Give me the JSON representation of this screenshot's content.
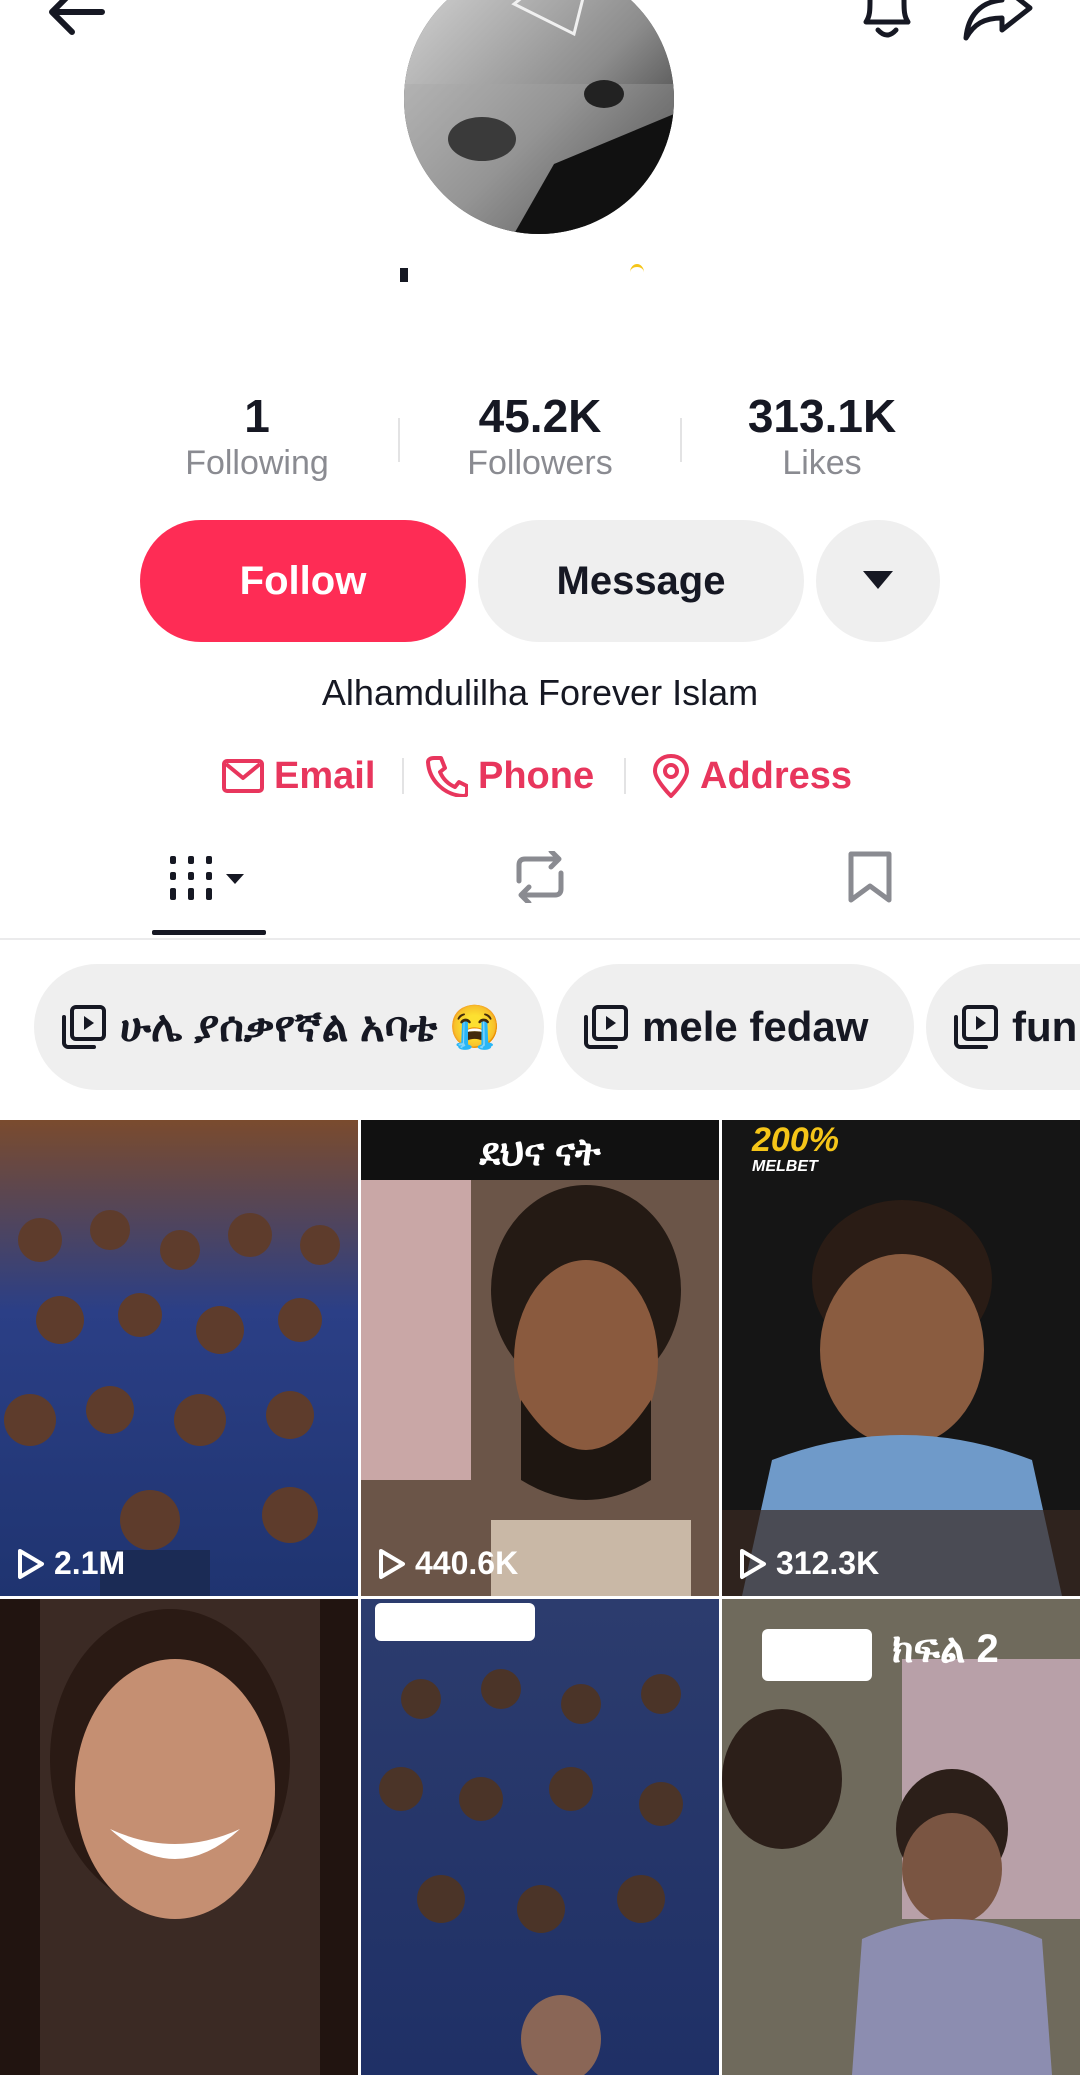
{
  "header": {
    "back_icon": "arrow-left-icon",
    "bell_icon": "bell-icon",
    "share_icon": "share-arrow-icon"
  },
  "stats": {
    "following_count": "1",
    "following_label": "Following",
    "followers_count": "45.2K",
    "followers_label": "Followers",
    "likes_count": "313.1K",
    "likes_label": "Likes"
  },
  "actions": {
    "follow_label": "Follow",
    "message_label": "Message",
    "more_icon": "caret-down-icon"
  },
  "bio": "Alhamdulilha Forever Islam",
  "contacts": {
    "email_label": "Email",
    "phone_label": "Phone",
    "address_label": "Address"
  },
  "tabs": [
    {
      "name": "videos",
      "icon": "grid-icon"
    },
    {
      "name": "reposts",
      "icon": "repost-icon"
    },
    {
      "name": "saved",
      "icon": "bookmark-icon"
    }
  ],
  "playlists": [
    {
      "label": "ሁሌ ያሰቃየኛል አባቴ 😭"
    },
    {
      "label": "mele fedaw"
    },
    {
      "label": "fun"
    }
  ],
  "videos": [
    {
      "views": "2.1M"
    },
    {
      "views": "440.6K",
      "caption": "ደህና ናት"
    },
    {
      "views": "312.3K",
      "badge": "200%",
      "badge_sub": "MELBET"
    },
    {
      "views": ""
    },
    {
      "views": ""
    },
    {
      "views": "",
      "caption": "ክፍል 2"
    }
  ],
  "colors": {
    "accent": "#fe2c55",
    "link": "#e8365d",
    "secondary_button": "#efefef"
  }
}
